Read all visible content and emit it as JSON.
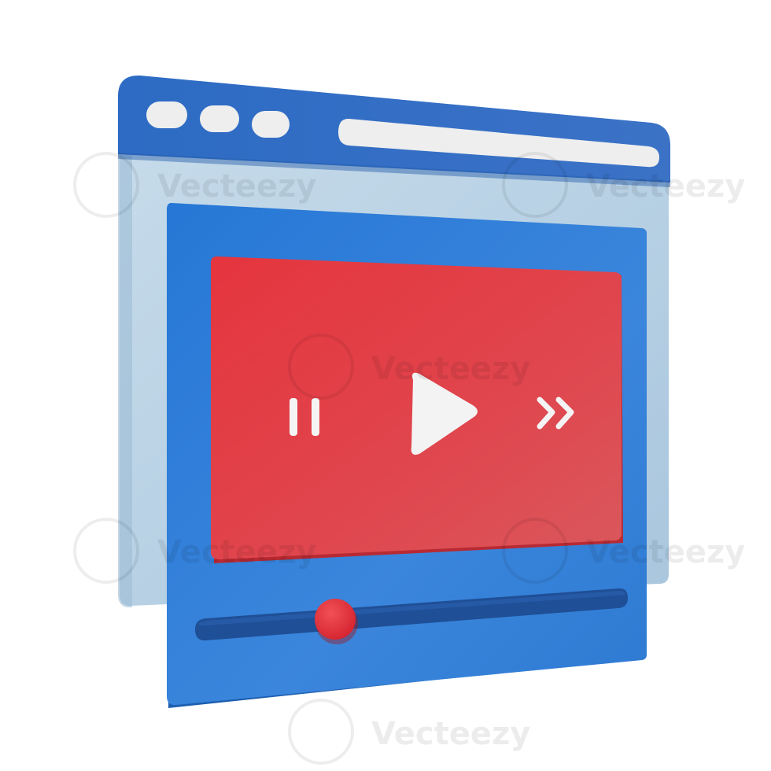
{
  "illustration": {
    "subject": "browser window with video player",
    "colors": {
      "window_header": "#2f6fc4",
      "window_back_panel": "#b9d3e6",
      "player_panel": "#2e7ed6",
      "video_screen": "#e23e46",
      "play_icon": "#f2f2f2",
      "timeline_track": "#1f4f96",
      "timeline_handle": "#e02f38",
      "window_dot": "#eeeeee",
      "address_bar": "#eeeeee"
    },
    "window_controls": [
      "window-dot",
      "window-dot",
      "window-dot"
    ],
    "player": {
      "controls": [
        "pause-icon",
        "play-icon",
        "fast-forward-icon"
      ],
      "progress": 0.3
    }
  },
  "watermark": {
    "text": "Vecteezy"
  }
}
